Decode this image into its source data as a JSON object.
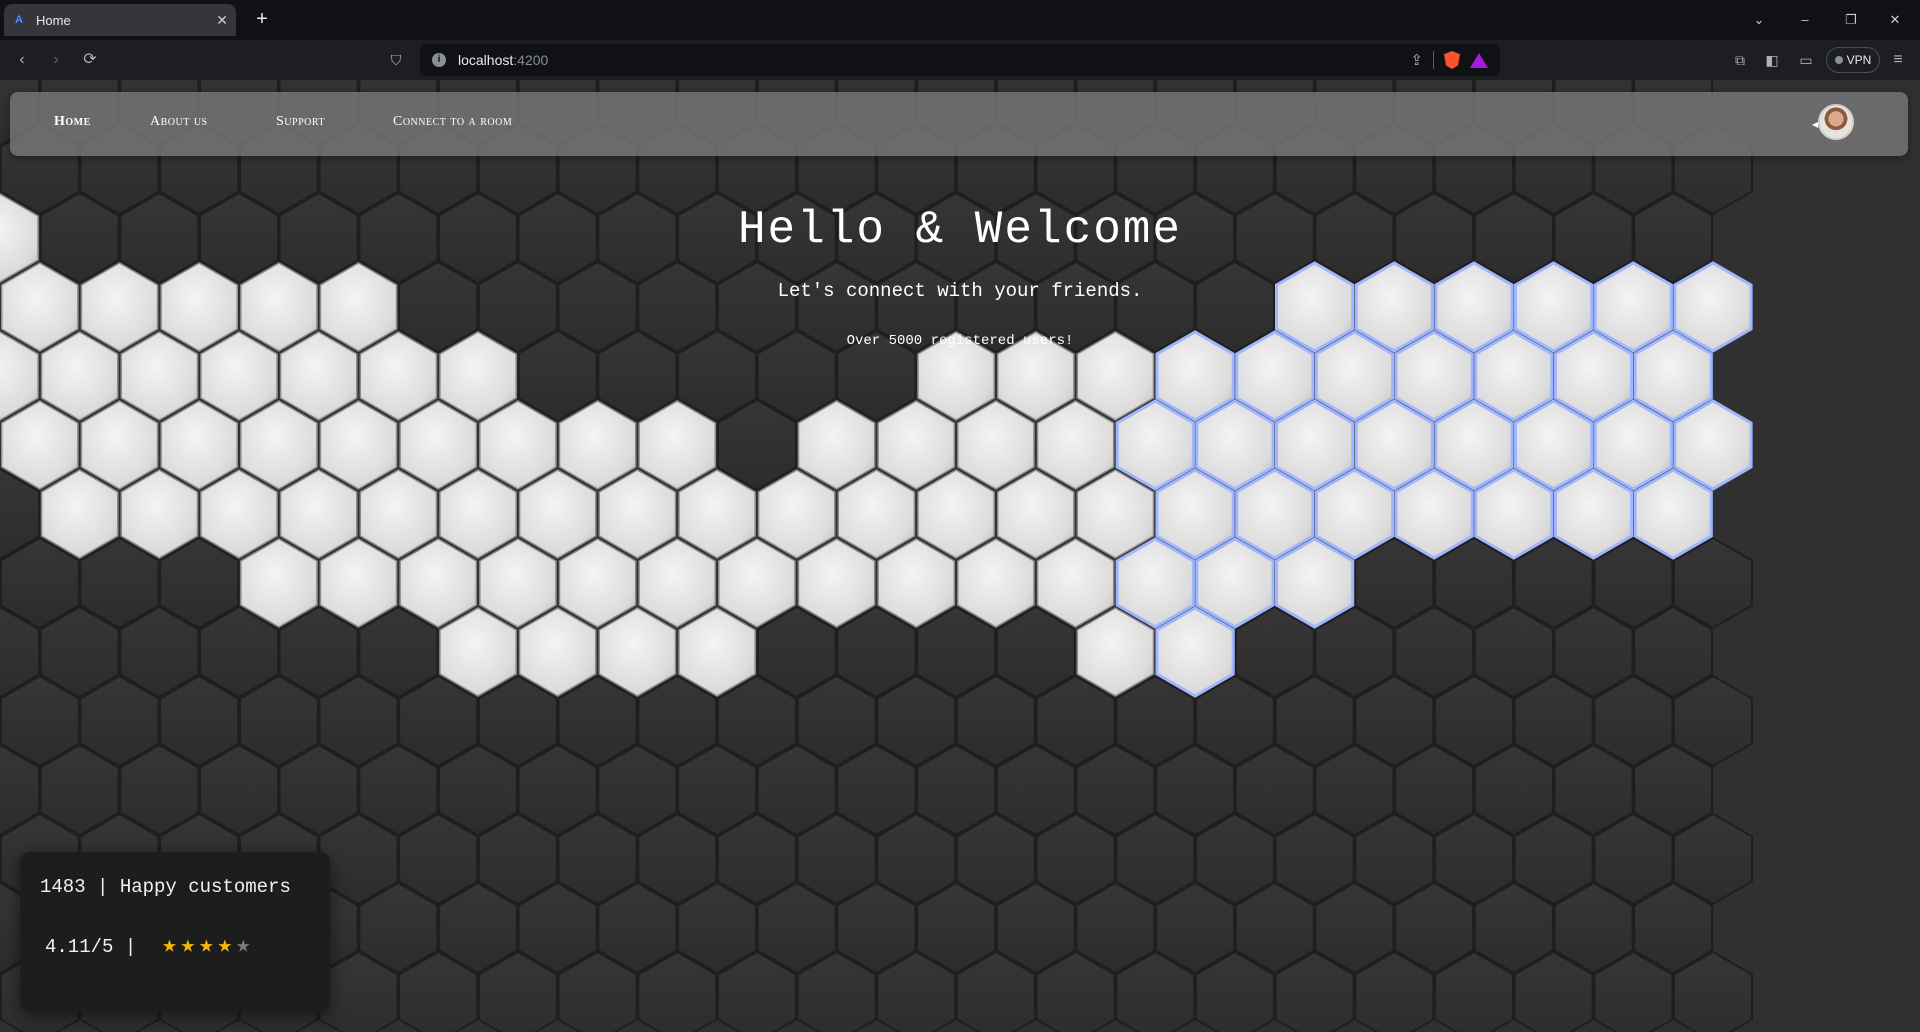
{
  "browser": {
    "tab": {
      "title": "Home",
      "favicon": "angular-favicon"
    },
    "new_tab_label": "+",
    "window_controls": {
      "list": "⌄",
      "minimize": "–",
      "restore": "❐",
      "close": "✕"
    },
    "nav_icons": {
      "back": "‹",
      "forward": "›",
      "reload": "⟳",
      "bookmark": "⛉"
    },
    "address": {
      "host": "localhost",
      "port": ":4200"
    },
    "vpn_label": "VPN",
    "right_icons": [
      "extensions-icon",
      "sidebar-icon",
      "wallet-icon",
      "menu-icon"
    ]
  },
  "nav": {
    "links": [
      {
        "label": "Home",
        "active": true
      },
      {
        "label": "About us",
        "active": false
      },
      {
        "label": "Support",
        "active": false
      },
      {
        "label": "Connect to a room",
        "active": false
      }
    ]
  },
  "hero": {
    "title": "Hello & Welcome",
    "subtitle": "Let's connect with your friends.",
    "users_text": "Over 5000 registered users!"
  },
  "stats": {
    "customers_line": "1483 | Happy customers",
    "rating_line": "4.11/5 |",
    "rating_value": 4.11,
    "stars_filled": 4,
    "stars_total": 5
  },
  "colors": {
    "nav_bg": "#787878",
    "page_bg": "#303030",
    "star_on": "#f5b50a",
    "star_off": "#7a7a7a",
    "hex_glow": "#9fb6ff"
  }
}
